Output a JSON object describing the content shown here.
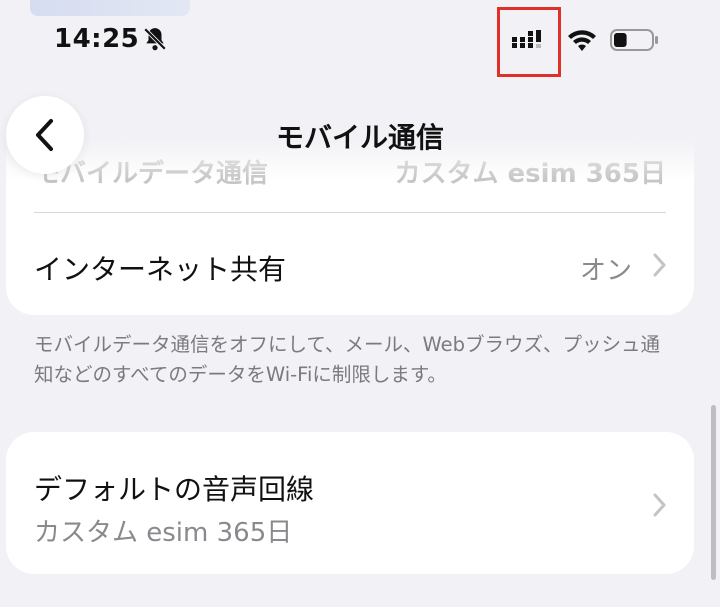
{
  "status_bar": {
    "time": "14:25",
    "silent_icon": "bell-slash-icon",
    "signal_icon": "cellular-signal-icon",
    "wifi_icon": "wifi-icon",
    "battery_icon": "battery-icon",
    "battery_level": 0.35,
    "highlight_color": "#e0302a"
  },
  "nav": {
    "back_icon": "chevron-left-icon",
    "title": "モバイル通信"
  },
  "cellular_data_row": {
    "label": "モバイルデータ通信",
    "value": "カスタム esim 365日"
  },
  "hotspot_row": {
    "label": "インターネット共有",
    "value": "オン"
  },
  "footnote": "モバイルデータ通信をオフにして、メール、Webブラウズ、プッシュ通知などのすべてのデータをWi-Fiに制限します。",
  "default_voice_line": {
    "label": "デフォルトの音声回線",
    "value": "カスタム esim 365日"
  }
}
